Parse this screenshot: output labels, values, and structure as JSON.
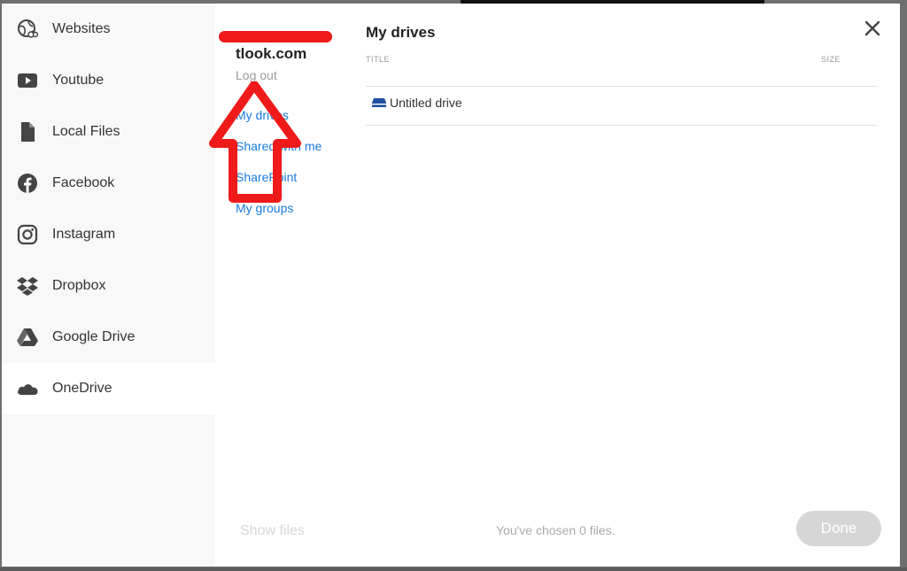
{
  "sidebar": {
    "items": [
      {
        "label": "Websites",
        "icon": "globe-icon"
      },
      {
        "label": "Youtube",
        "icon": "youtube-icon"
      },
      {
        "label": "Local Files",
        "icon": "file-icon"
      },
      {
        "label": "Facebook",
        "icon": "facebook-icon"
      },
      {
        "label": "Instagram",
        "icon": "instagram-icon"
      },
      {
        "label": "Dropbox",
        "icon": "dropbox-icon"
      },
      {
        "label": "Google Drive",
        "icon": "google-drive-icon"
      },
      {
        "label": "OneDrive",
        "icon": "onedrive-icon"
      }
    ],
    "active": "OneDrive"
  },
  "account": {
    "name": "tlook.com",
    "logout_label": "Log out",
    "nav": [
      {
        "label": "My drives"
      },
      {
        "label": "Shared with me"
      },
      {
        "label": "SharePoint"
      },
      {
        "label": "My groups"
      }
    ]
  },
  "main": {
    "title": "My drives",
    "columns": {
      "title": "TITLE",
      "size": "SIZE"
    },
    "rows": [
      {
        "name": "Untitled drive",
        "icon": "drive-icon"
      }
    ]
  },
  "footer": {
    "show_files_label": "Show files",
    "status": "You've chosen 0 files.",
    "done_label": "Done"
  },
  "colors": {
    "link": "#1a7be0",
    "annotation": "#ef1a1a",
    "drive_icon": "#1e4fa0"
  }
}
